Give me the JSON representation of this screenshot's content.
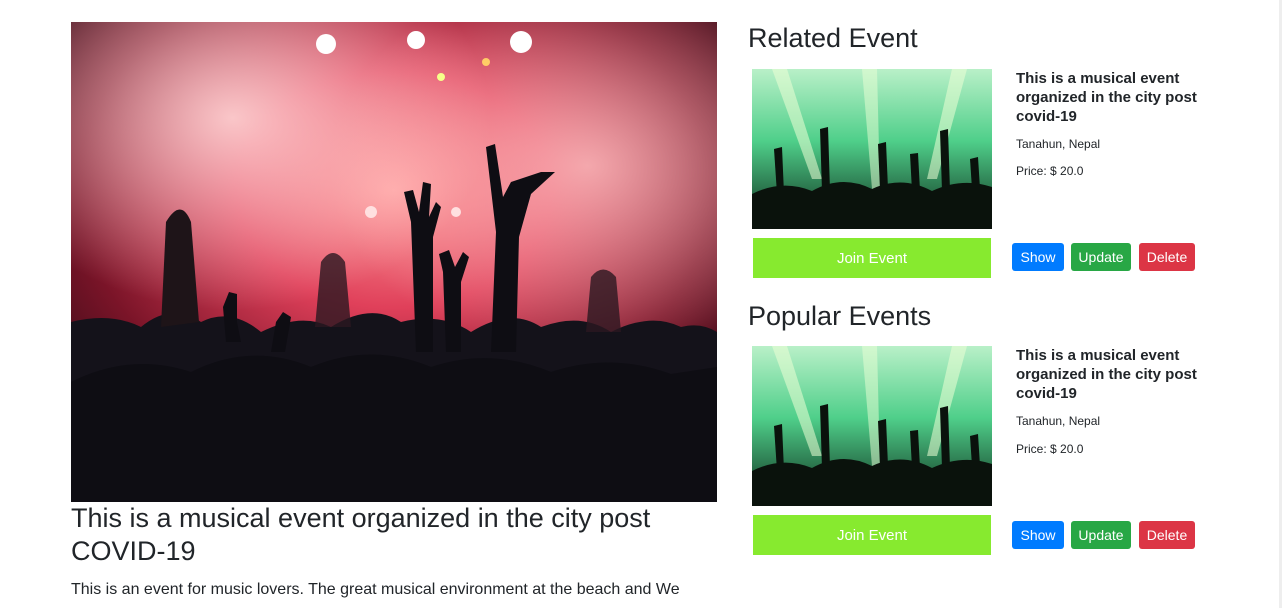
{
  "main_event": {
    "title": "This is a musical event organized in the city post COVID-19",
    "description": "This is an event for music lovers. The great musical environment at the beach and We"
  },
  "related": {
    "heading": "Related Event",
    "card": {
      "title": "This is a musical event organized in the city post covid-19",
      "location": "Tanahun, Nepal",
      "price": "Price: $ 20.0",
      "join_label": "Join Event",
      "show_label": "Show",
      "update_label": "Update",
      "delete_label": "Delete"
    }
  },
  "popular": {
    "heading": "Popular Events",
    "card": {
      "title": "This is a musical event organized in the city post covid-19",
      "location": "Tanahun, Nepal",
      "price": "Price: $ 20.0",
      "join_label": "Join Event",
      "show_label": "Show",
      "update_label": "Update",
      "delete_label": "Delete"
    }
  },
  "colors": {
    "join": "#87ea2f",
    "show": "#007bff",
    "update": "#28a745",
    "delete": "#dc3545"
  }
}
